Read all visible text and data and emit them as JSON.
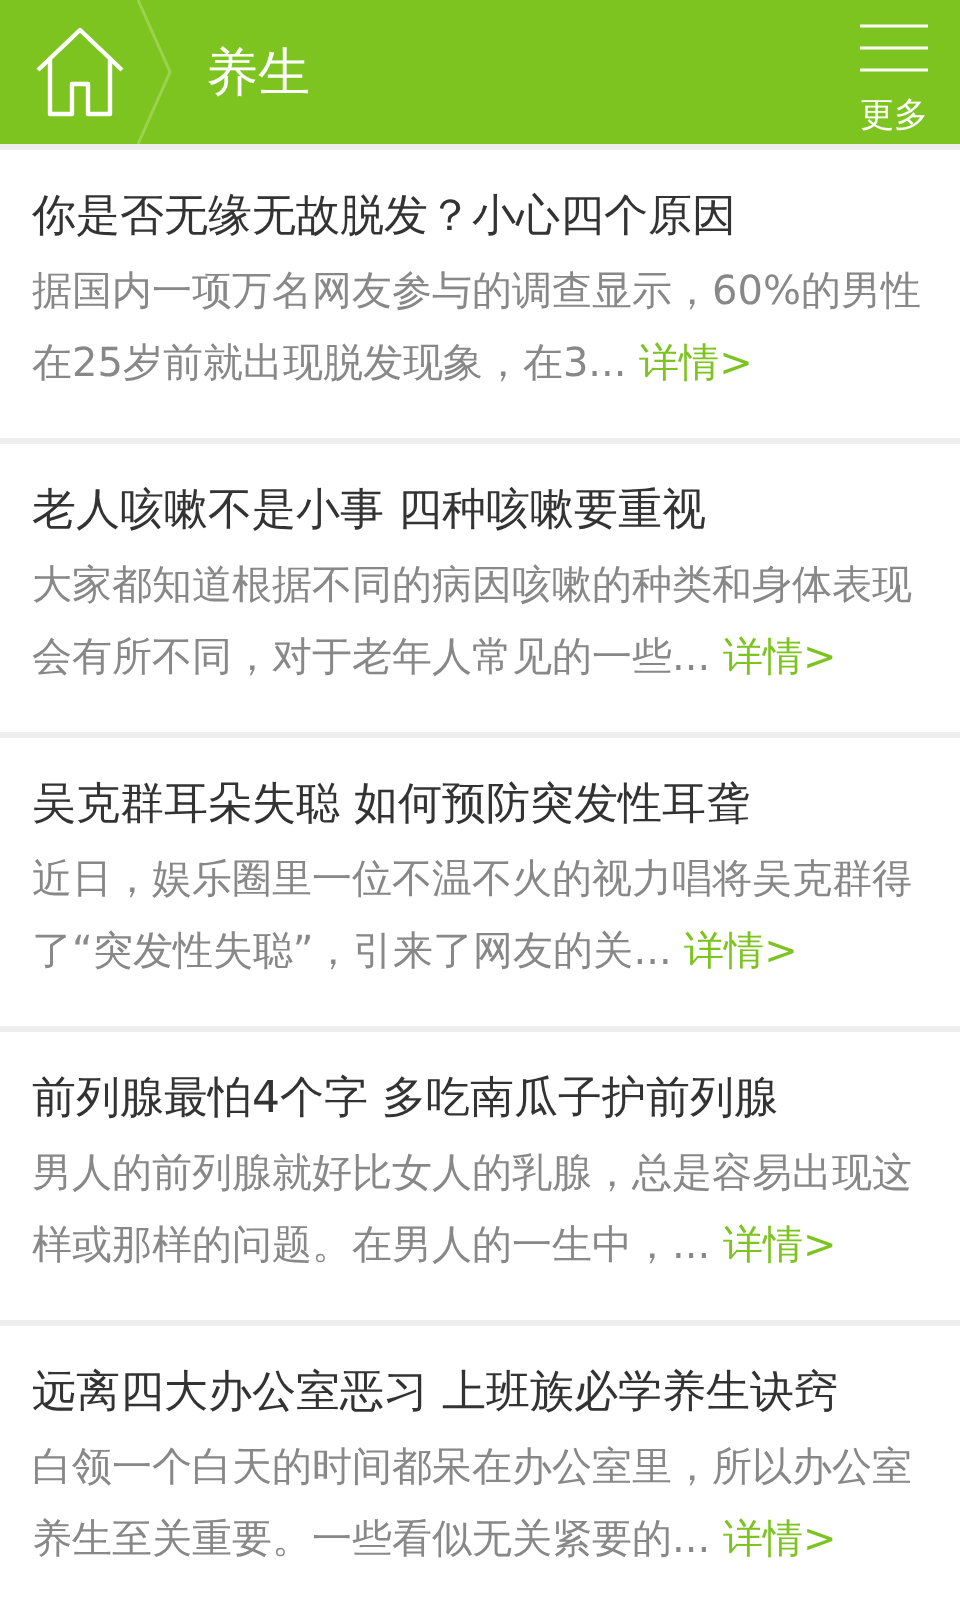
{
  "header": {
    "title": "养生",
    "more_label": "更多"
  },
  "articles": [
    {
      "title": "你是否无缘无故脱发？小心四个原因",
      "summary": "据国内一项万名网友参与的调查显示，60%的男性在25岁前就出现脱发现象，在3...",
      "link": "详情>"
    },
    {
      "title": "老人咳嗽不是小事 四种咳嗽要重视",
      "summary": "大家都知道根据不同的病因咳嗽的种类和身体表现会有所不同，对于老年人常见的一些...",
      "link": "详情>"
    },
    {
      "title": "吴克群耳朵失聪 如何预防突发性耳聋",
      "summary": "近日，娱乐圈里一位不温不火的视力唱将吴克群得了“突发性失聪”，引来了网友的关...",
      "link": "详情>"
    },
    {
      "title": "前列腺最怕4个字 多吃南瓜子护前列腺",
      "summary": "男人的前列腺就好比女人的乳腺，总是容易出现这样或那样的问题。在男人的一生中，...",
      "link": "详情>"
    },
    {
      "title": "远离四大办公室恶习 上班族必学养生诀窍",
      "summary": "白领一个白天的时间都呆在办公室里，所以办公室养生至关重要。一些看似无关紧要的...",
      "link": "详情>"
    }
  ]
}
